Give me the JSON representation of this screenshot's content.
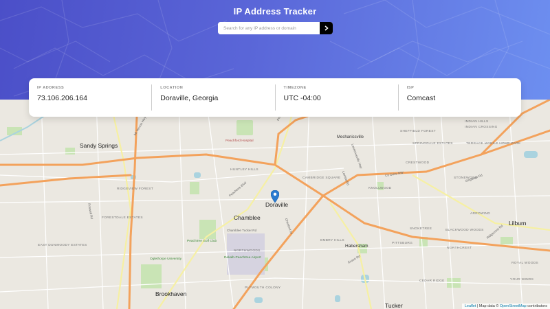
{
  "header": {
    "title": "IP Address Tracker",
    "search_placeholder": "Search for any IP address or domain"
  },
  "info": [
    {
      "label": "IP ADDRESS",
      "value": "73.106.206.164"
    },
    {
      "label": "LOCATION",
      "value": "Doraville, Georgia"
    },
    {
      "label": "TIMEZONE",
      "value": "UTC -04:00"
    },
    {
      "label": "ISP",
      "value": "Comcast"
    }
  ],
  "map": {
    "places_big": [
      "Sandy Springs",
      "Doraville",
      "Chamblee",
      "Brookhaven",
      "Tucker",
      "Lilburn",
      "Mechanicsville",
      "Habersham"
    ],
    "places_small": [
      "INDIAN HILLS",
      "INDIAN CROSSING",
      "TERRACE MOBILE HOME PARK",
      "SHEFFIELD FOREST",
      "SPRINGDALE ESTATES",
      "CRESTWOOD",
      "STONEWOOD",
      "KNOLLWOOD",
      "HUNTLEY HILLS",
      "CAMBRIDGE SQUARE",
      "RIDGEVIEW FOREST",
      "FORESTDALE ESTATES",
      "EAST DUNWOODY ESTATES",
      "NORTHWOODS",
      "EMBRY HILLS",
      "SNOKETREE",
      "BLACKWOOD WOODS",
      "ARROWIND",
      "PITTSBURG",
      "CEDAR RIDGE",
      "YOUR WINDS",
      "PLYMOUTH COLONY",
      "NORTHCREST",
      "ROYAL WOODS"
    ],
    "places_green": [
      "Peachtree Golf Club",
      "Oglethorpe University",
      "Dekalb-Peachtree Airport"
    ],
    "places_red": [
      "Peachford Hospital"
    ],
    "roads": [
      "Peachtree Blvd",
      "Chamblee Tucker Rd",
      "Peachtree Rd",
      "Lavista Rd",
      "Lawrenceville Hwy",
      "Ridgecrest Rd",
      "Singleton Rd",
      "Evans Rd",
      "Cir Drive NW",
      "Chestnut Dr",
      "Roswell Rd",
      "Mt Vernon Hwy"
    ],
    "attribution_leaflet": "Leaflet",
    "attribution_sep": " | Map data © ",
    "attribution_osm": "OpenStreetMap",
    "attribution_tail": " contributors"
  }
}
